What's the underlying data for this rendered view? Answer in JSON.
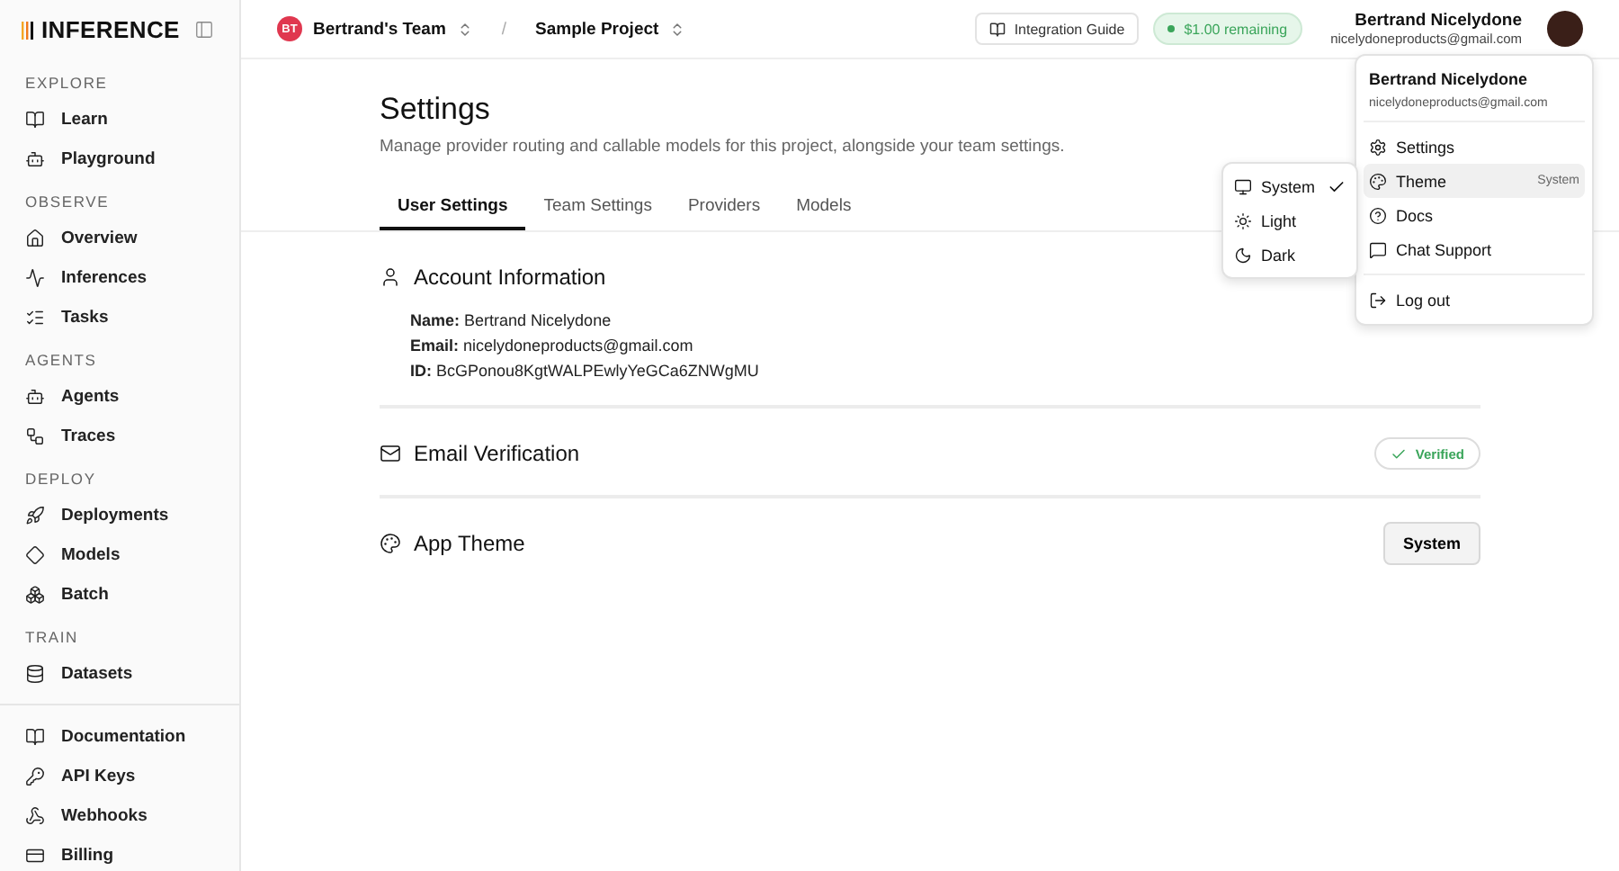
{
  "brand": "INFERENCE",
  "sidebar": {
    "sections": [
      {
        "heading": "EXPLORE",
        "items": [
          {
            "label": "Learn"
          },
          {
            "label": "Playground"
          }
        ]
      },
      {
        "heading": "OBSERVE",
        "items": [
          {
            "label": "Overview"
          },
          {
            "label": "Inferences"
          },
          {
            "label": "Tasks"
          }
        ]
      },
      {
        "heading": "AGENTS",
        "items": [
          {
            "label": "Agents"
          },
          {
            "label": "Traces"
          }
        ]
      },
      {
        "heading": "DEPLOY",
        "items": [
          {
            "label": "Deployments"
          },
          {
            "label": "Models"
          },
          {
            "label": "Batch"
          }
        ]
      },
      {
        "heading": "TRAIN",
        "items": [
          {
            "label": "Datasets"
          }
        ]
      }
    ],
    "footer_items": [
      {
        "label": "Documentation"
      },
      {
        "label": "API Keys"
      },
      {
        "label": "Webhooks"
      },
      {
        "label": "Billing"
      }
    ]
  },
  "topbar": {
    "team": {
      "initials": "BT",
      "name": "Bertrand's Team"
    },
    "separator": "/",
    "project": "Sample Project",
    "guide": "Integration Guide",
    "credit": "$1.00 remaining",
    "user": {
      "name": "Bertrand Nicelydone",
      "email": "nicelydoneproducts@gmail.com"
    }
  },
  "page": {
    "title": "Settings",
    "subtitle": "Manage provider routing and callable models for this project, alongside your team settings.",
    "tabs": [
      {
        "label": "User Settings",
        "selected": true
      },
      {
        "label": "Team Settings",
        "selected": false
      },
      {
        "label": "Providers",
        "selected": false
      },
      {
        "label": "Models",
        "selected": false
      }
    ],
    "account": {
      "title": "Account Information",
      "fields": [
        {
          "label": "Name:",
          "value": "Bertrand Nicelydone"
        },
        {
          "label": "Email:",
          "value": "nicelydoneproducts@gmail.com"
        },
        {
          "label": "ID:",
          "value": "BcGPonou8KgtWALPEwlyYeGCa6ZNWgMU"
        }
      ]
    },
    "email_verification": {
      "title": "Email Verification",
      "badge": "Verified"
    },
    "app_theme": {
      "title": "App Theme",
      "button": "System"
    }
  },
  "user_menu": {
    "name": "Bertrand Nicelydone",
    "email": "nicelydoneproducts@gmail.com",
    "items": [
      {
        "label": "Settings",
        "highlighted": false
      },
      {
        "label": "Theme",
        "value": "System",
        "highlighted": true
      },
      {
        "label": "Docs",
        "highlighted": false
      },
      {
        "label": "Chat Support",
        "highlighted": false
      }
    ],
    "logout": "Log out"
  },
  "theme_menu": [
    {
      "label": "System",
      "selected": true
    },
    {
      "label": "Light",
      "selected": false
    },
    {
      "label": "Dark",
      "selected": false
    }
  ]
}
